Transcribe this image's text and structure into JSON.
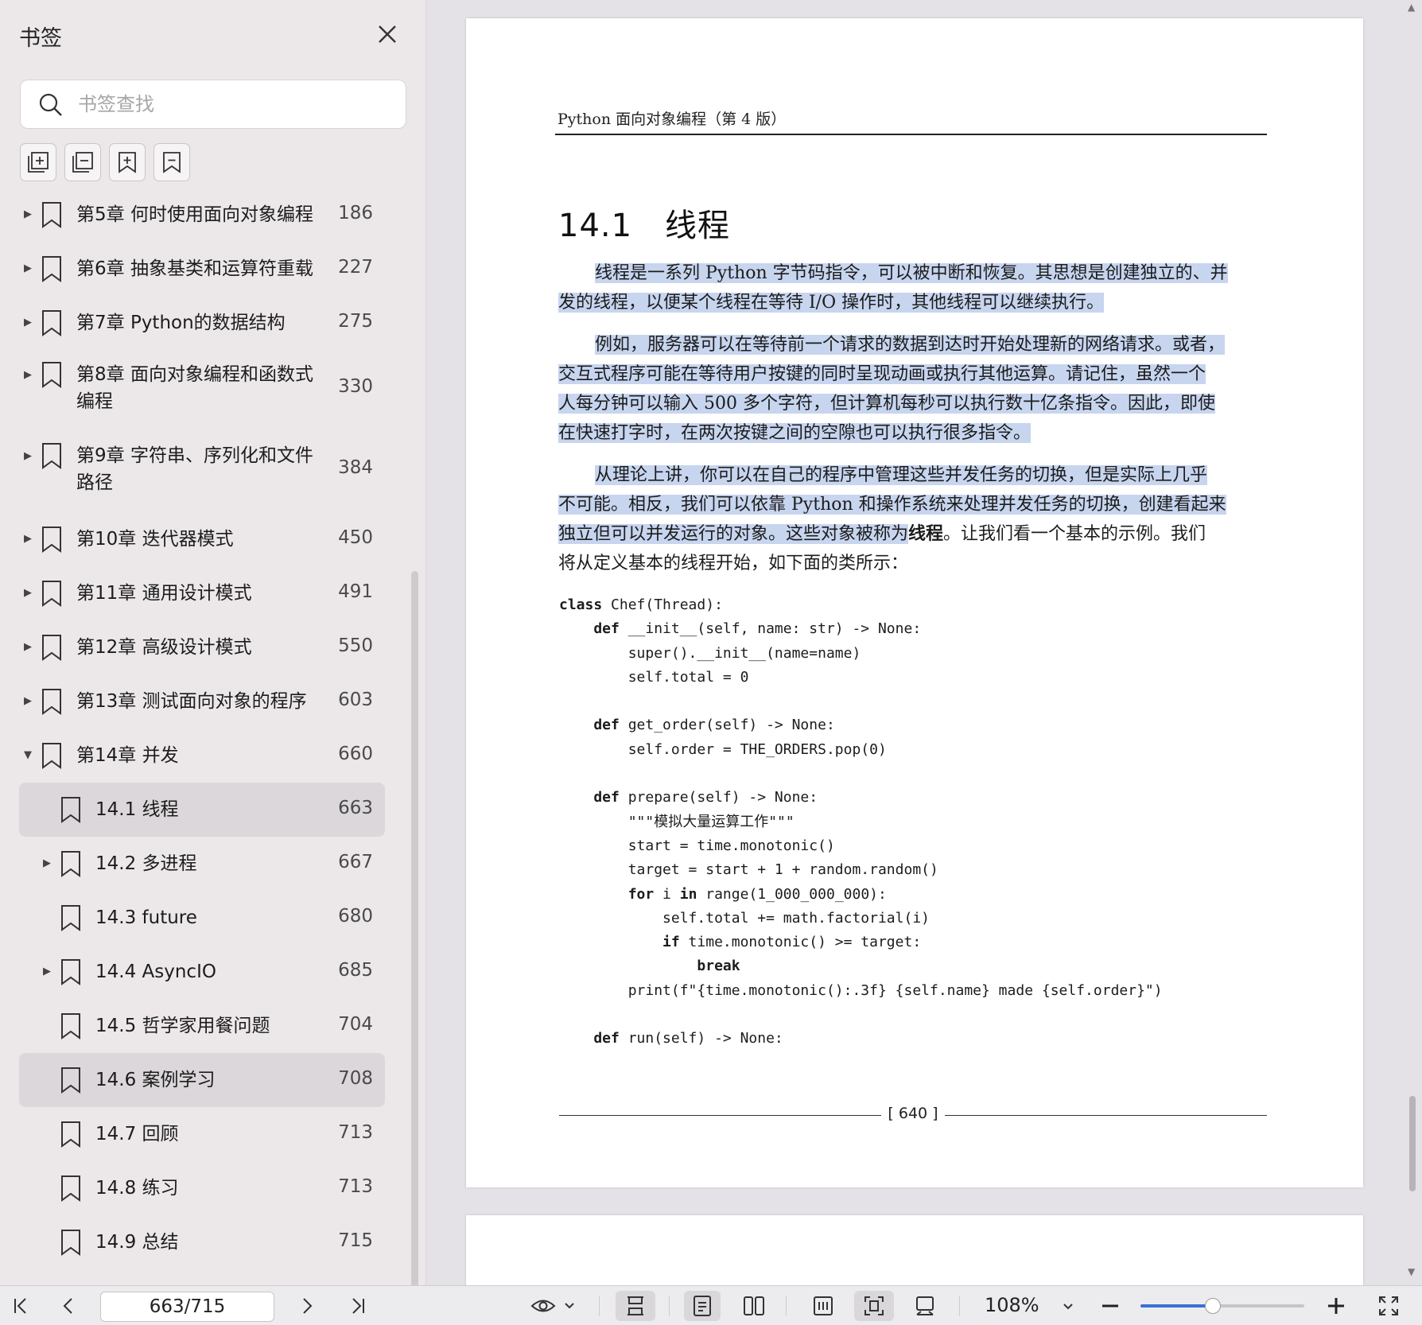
{
  "sidebar": {
    "title": "书签",
    "search_placeholder": "书签查找",
    "bookmarks": [
      {
        "label": "第5章 何时使用面向对象编程",
        "page": "186",
        "expanded": false,
        "level": 0
      },
      {
        "label": "第6章 抽象基类和运算符重载",
        "page": "227",
        "expanded": false,
        "level": 0
      },
      {
        "label": "第7章 Python的数据结构",
        "page": "275",
        "expanded": false,
        "level": 0
      },
      {
        "label": "第8章 面向对象编程和函数式",
        "label2": "编程",
        "page": "330",
        "expanded": false,
        "level": 0
      },
      {
        "label": "第9章 字符串、序列化和文件",
        "label2": "路径",
        "page": "384",
        "expanded": false,
        "level": 0
      },
      {
        "label": "第10章 迭代器模式",
        "page": "450",
        "expanded": false,
        "level": 0
      },
      {
        "label": "第11章 通用设计模式",
        "page": "491",
        "expanded": false,
        "level": 0
      },
      {
        "label": "第12章 高级设计模式",
        "page": "550",
        "expanded": false,
        "level": 0
      },
      {
        "label": "第13章 测试面向对象的程序",
        "page": "603",
        "expanded": false,
        "level": 0
      },
      {
        "label": "第14章 并发",
        "page": "660",
        "expanded": true,
        "level": 0
      },
      {
        "label": "14.1 线程",
        "page": "663",
        "level": 1,
        "selected": true
      },
      {
        "label": "14.2 多进程",
        "page": "667",
        "level": 1,
        "expanded": false
      },
      {
        "label": "14.3 future",
        "page": "680",
        "level": 1
      },
      {
        "label": "14.4 AsyncIO",
        "page": "685",
        "level": 1,
        "expanded": false
      },
      {
        "label": "14.5 哲学家用餐问题",
        "page": "704",
        "level": 1
      },
      {
        "label": "14.6 案例学习",
        "page": "708",
        "level": 1,
        "hover": true
      },
      {
        "label": "14.7 回顾",
        "page": "713",
        "level": 1
      },
      {
        "label": "14.8 练习",
        "page": "713",
        "level": 1
      },
      {
        "label": "14.9 总结",
        "page": "715",
        "level": 1
      }
    ]
  },
  "document": {
    "running_header": "Python 面向对象编程（第 4 版）",
    "section_title": "14.1　线程",
    "p1": {
      "l1": "线程是一系列 Python 字节码指令，可以被中断和恢复。其思想是创建独立的、并",
      "l2": "发的线程，以便某个线程在等待 I/O 操作时，其他线程可以继续执行。"
    },
    "p2": {
      "l1": "例如，服务器可以在等待前一个请求的数据到达时开始处理新的网络请求。或者，",
      "l2": "交互式程序可能在等待用户按键的同时呈现动画或执行其他运算。请记住，虽然一个",
      "l3": "人每分钟可以输入 500 多个字符，但计算机每秒可以执行数十亿条指令。因此，即使",
      "l4": "在快速打字时，在两次按键之间的空隙也可以执行很多指令。"
    },
    "p3": {
      "l1": "从理论上讲，你可以在自己的程序中管理这些并发任务的切换，但是实际上几乎",
      "l2": "不可能。相反，我们可以依靠 Python 和操作系统来处理并发任务的切换，创建看起来",
      "l3": "独立但可以并发运行的对象。这些对象被称为",
      "l3_bold": "线程",
      "l3_rest": "。让我们看一个基本的示例。我们",
      "l4": "将从定义基本的线程开始，如下面的类所示："
    },
    "code": {
      "c1a": "class",
      "c1b": " Chef(Thread):",
      "c2a": "    def",
      "c2b": " __init__(self, name: str) -> None:",
      "c3": "        super().__init__(name=name)",
      "c4": "        self.total = 0",
      "c5": "",
      "c6a": "    def",
      "c6b": " get_order(self) -> None:",
      "c7": "        self.order = THE_ORDERS.pop(0)",
      "c8": "",
      "c9a": "    def",
      "c9b": " prepare(self) -> None:",
      "c10": "        \"\"\"模拟大量运算工作\"\"\"",
      "c11": "        start = time.monotonic()",
      "c12": "        target = start + 1 + random.random()",
      "c13a": "        for",
      "c13b": " i ",
      "c13c": "in",
      "c13d": " range(1_000_000_000):",
      "c14": "            self.total += math.factorial(i)",
      "c15a": "            if",
      "c15b": " time.monotonic() >= target:",
      "c16a": "                break",
      "c17": "        print(f\"{time.monotonic():.3f} {self.name} made {self.order}\")",
      "c18": "",
      "c19a": "    def",
      "c19b": " run(self) -> None:"
    },
    "page_footer": "[ 640 ]"
  },
  "toolbar": {
    "page_indicator": "663/715",
    "zoom": "108%",
    "zoom_slider_fraction": 0.44
  },
  "colors": {
    "highlight": "#c7d5ef",
    "accent": "#3a6fd8",
    "sidebar_bg": "#ece8ea"
  }
}
